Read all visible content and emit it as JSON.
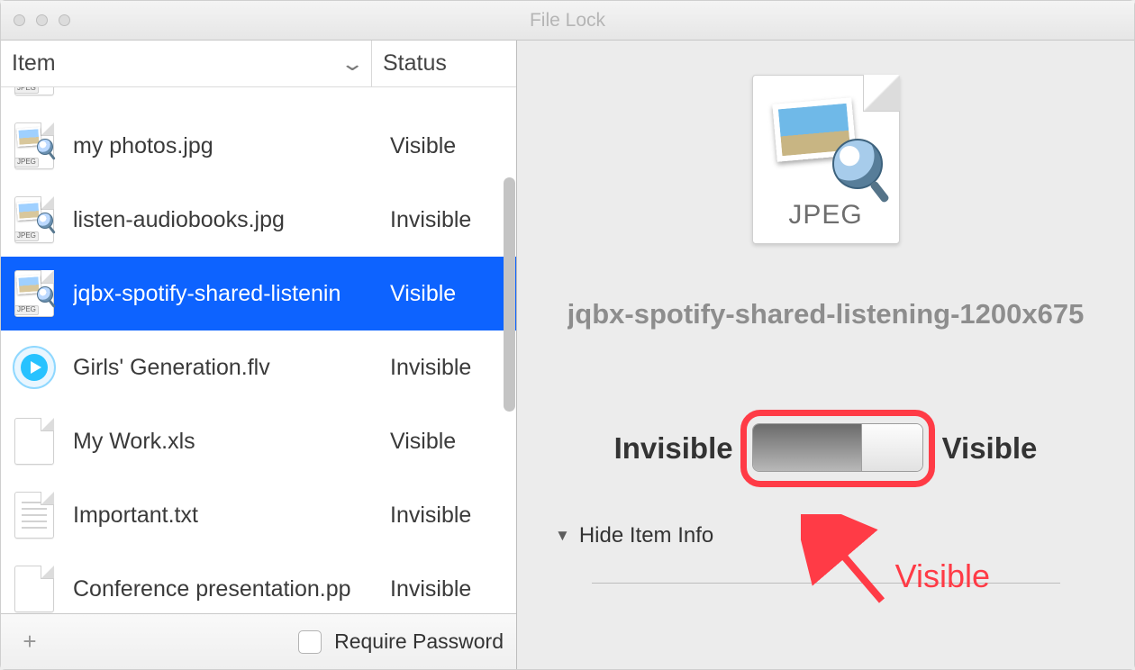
{
  "window": {
    "title": "File Lock"
  },
  "table": {
    "columns": {
      "item": "Item",
      "status": "Status"
    }
  },
  "files": [
    {
      "name": "",
      "status": "",
      "type": "jpeg",
      "selected": false
    },
    {
      "name": "my photos.jpg",
      "status": "Visible",
      "type": "jpeg",
      "selected": false
    },
    {
      "name": "listen-audiobooks.jpg",
      "status": "Invisible",
      "type": "jpeg",
      "selected": false
    },
    {
      "name": "jqbx-spotify-shared-listenin",
      "status": "Visible",
      "type": "jpeg",
      "selected": true
    },
    {
      "name": "Girls' Generation.flv",
      "status": "Invisible",
      "type": "flv",
      "selected": false
    },
    {
      "name": "My Work.xls",
      "status": "Visible",
      "type": "doc",
      "selected": false
    },
    {
      "name": "Important.txt",
      "status": "Invisible",
      "type": "txt",
      "selected": false
    },
    {
      "name": "Conference presentation.pp",
      "status": "Invisible",
      "type": "doc",
      "selected": false
    }
  ],
  "footer": {
    "require_password": "Require Password",
    "require_password_checked": false
  },
  "detail": {
    "badge": "JPEG",
    "filename": "jqbx-spotify-shared-listening-1200x675",
    "label_invisible": "Invisible",
    "label_visible": "Visible",
    "visibility_state": "visible",
    "hide_item_info": "Hide Item Info"
  },
  "annotation": {
    "label": "Visible"
  }
}
